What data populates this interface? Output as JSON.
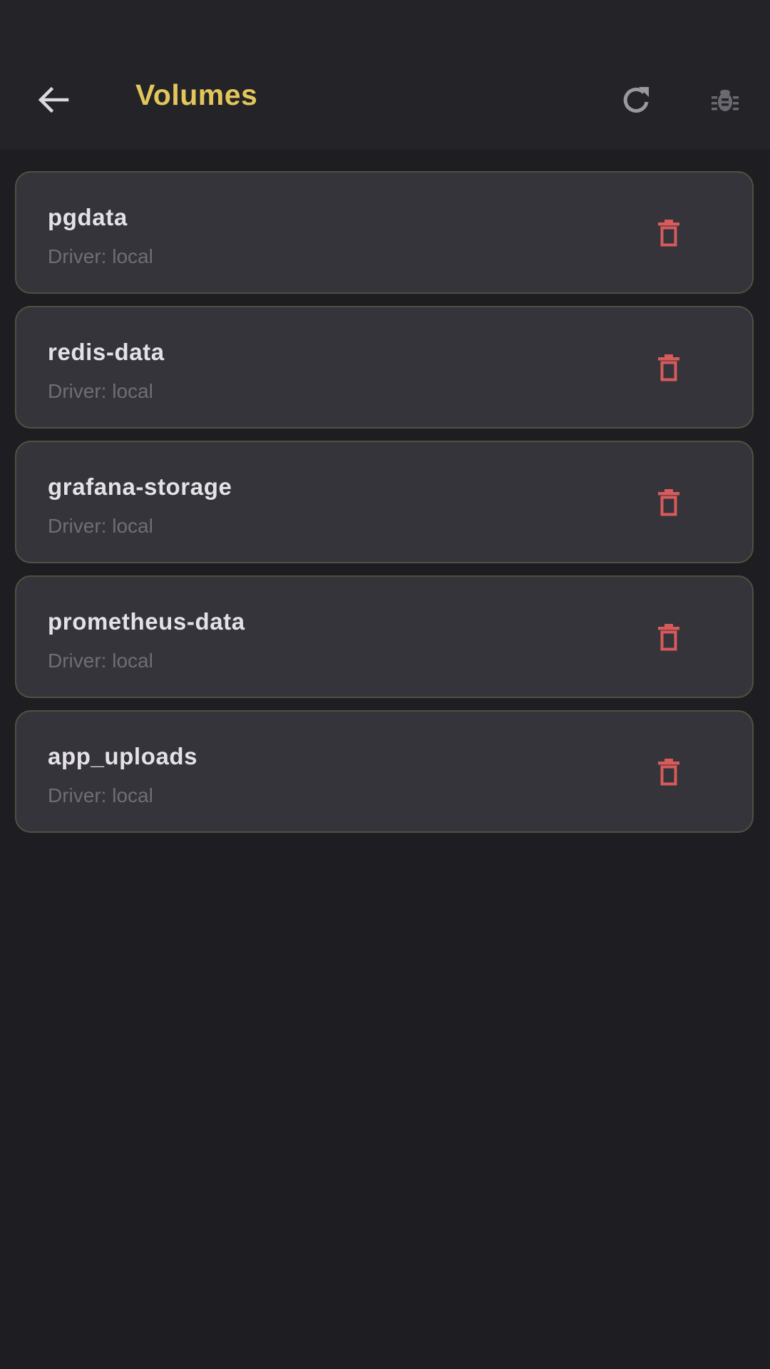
{
  "app_bar": {
    "title": "Volumes",
    "back_icon": "arrow-back-icon",
    "refresh_icon": "refresh-icon",
    "debug_icon": "bug-icon"
  },
  "colors": {
    "background": "#1e1d22",
    "app_bar": "#242328",
    "card": "#35343b",
    "card_border": "#525040",
    "accent": "#e2c65a",
    "delete": "#d95a5a"
  },
  "volumes": [
    {
      "name": "pgdata",
      "driver": "Driver: local"
    },
    {
      "name": "redis-data",
      "driver": "Driver: local"
    },
    {
      "name": "grafana-storage",
      "driver": "Driver: local"
    },
    {
      "name": "prometheus-data",
      "driver": "Driver: local"
    },
    {
      "name": "app_uploads",
      "driver": "Driver: local"
    }
  ]
}
